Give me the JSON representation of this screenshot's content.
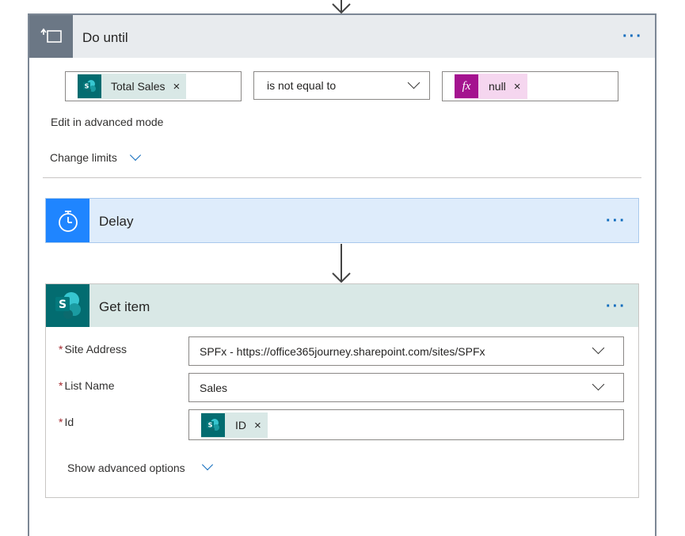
{
  "do_until": {
    "title": "Do until",
    "menu": "···",
    "condition": {
      "left_token": "Total Sales",
      "operator": "is not equal to",
      "right_token": "null",
      "fx_label": "fx",
      "remove": "×"
    },
    "advanced_mode": "Edit in advanced mode",
    "change_limits": "Change limits"
  },
  "delay": {
    "title": "Delay",
    "menu": "···"
  },
  "get_item": {
    "title": "Get item",
    "menu": "···",
    "required_marker": "*",
    "fields": [
      {
        "label": "Site Address",
        "value": "SPFx - https://office365journey.sharepoint.com/sites/SPFx"
      },
      {
        "label": "List Name",
        "value": "Sales"
      },
      {
        "label": "Id",
        "token": "ID",
        "remove": "×"
      }
    ],
    "show_advanced": "Show advanced options"
  },
  "colors": {
    "do_until_icon_bg": "#6b7785",
    "delay_icon_bg": "#1f85ff",
    "sharepoint_bg": "#036c70",
    "fx_bg": "#a4138f",
    "link_blue": "#0f6cbd"
  }
}
